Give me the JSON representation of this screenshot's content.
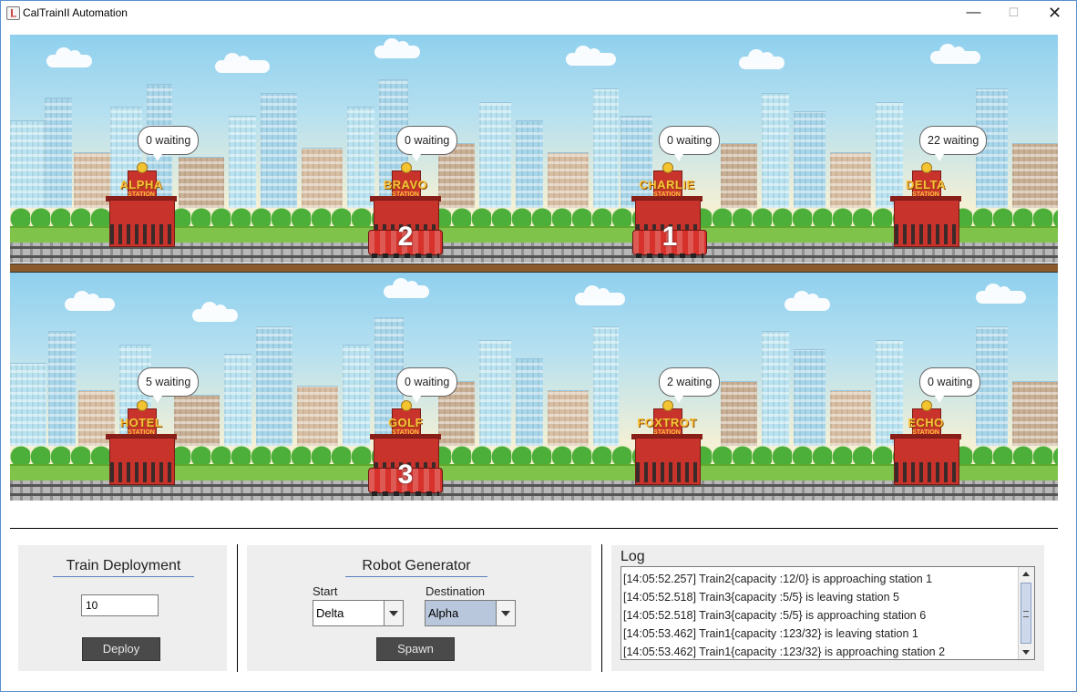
{
  "window": {
    "title": "CalTrainII Automation",
    "minimize": "—",
    "maximize": "☐",
    "close": "✕",
    "icon": "java-cup-icon"
  },
  "scene_top": {
    "stations": [
      {
        "name": "ALPHA",
        "sub": "STATION",
        "waiting": "0 waiting"
      },
      {
        "name": "BRAVO",
        "sub": "STATION",
        "waiting": "0 waiting"
      },
      {
        "name": "CHARLIE",
        "sub": "STATION",
        "waiting": "0 waiting"
      },
      {
        "name": "DELTA",
        "sub": "STATION",
        "waiting": "22 waiting"
      }
    ],
    "trains": [
      {
        "number": "2"
      },
      {
        "number": "1"
      }
    ]
  },
  "scene_bottom": {
    "stations": [
      {
        "name": "HOTEL",
        "sub": "STATION",
        "waiting": "5 waiting"
      },
      {
        "name": "GOLF",
        "sub": "STATION",
        "waiting": "0 waiting"
      },
      {
        "name": "FOXTROT",
        "sub": "STATION",
        "waiting": "2 waiting"
      },
      {
        "name": "ECHO",
        "sub": "STATION",
        "waiting": "0 waiting"
      }
    ],
    "trains": [
      {
        "number": "3"
      }
    ]
  },
  "train_deployment": {
    "title": "Train Deployment",
    "input_value": "10",
    "button": "Deploy"
  },
  "robot_generator": {
    "title": "Robot Generator",
    "start_label": "Start",
    "start_value": "Delta",
    "destination_label": "Destination",
    "destination_value": "Alpha",
    "button": "Spawn"
  },
  "log": {
    "title": "Log",
    "lines": [
      "[14:05:52.257] Train2{capacity :12/0} is approaching station 1",
      "[14:05:52.518] Train3{capacity :5/5} is leaving station 5",
      "[14:05:52.518] Train3{capacity :5/5} is approaching station 6",
      "[14:05:53.462] Train1{capacity :123/32} is leaving station 1",
      "[14:05:53.462] Train1{capacity :123/32} is approaching station 2"
    ]
  },
  "colors": {
    "accent": "#5b7fbf",
    "button_bg": "#4a4a4a",
    "panel_bg": "#eeeeee",
    "station_red": "#c8332b",
    "station_text": "#f9c23c"
  }
}
